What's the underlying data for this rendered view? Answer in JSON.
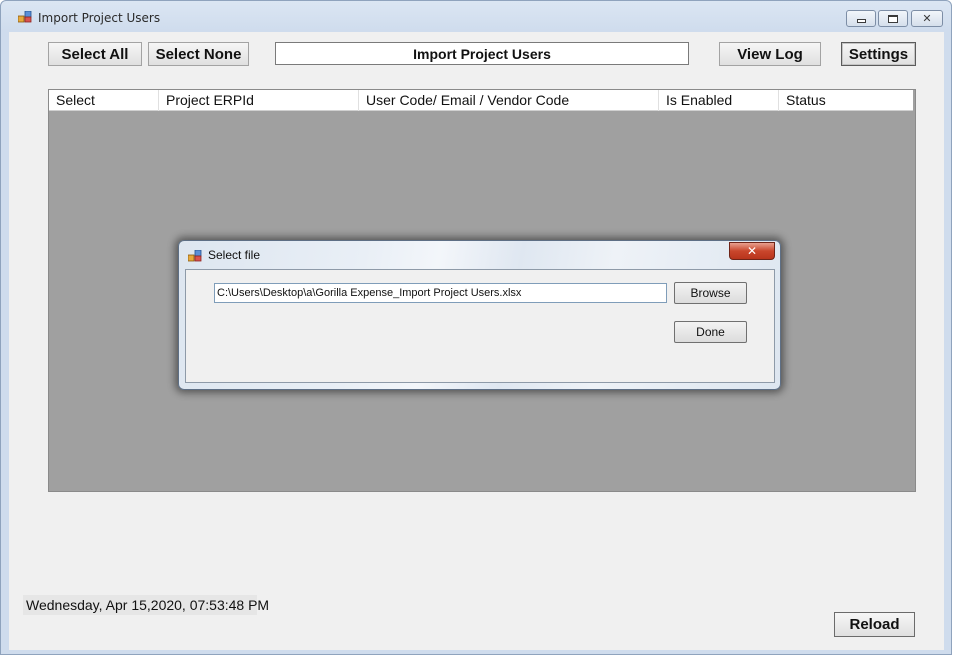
{
  "window": {
    "title": "Import Project Users"
  },
  "toolbar": {
    "select_all": "Select All",
    "select_none": "Select None",
    "title_box": "Import Project Users",
    "view_log": "View Log",
    "settings": "Settings"
  },
  "grid": {
    "columns": [
      "Select",
      "Project ERPId",
      "User Code/ Email / Vendor Code",
      "Is Enabled",
      "Status"
    ]
  },
  "footer": {
    "datetime": "Wednesday, Apr 15,2020, 07:53:48 PM",
    "reload": "Reload"
  },
  "dialog": {
    "title": "Select file",
    "close_glyph": "✕",
    "file_path": "C:\\Users\\Desktop\\a\\Gorilla Expense_Import Project Users.xlsx",
    "browse": "Browse",
    "done": "Done"
  },
  "colors": {
    "grid_background": "#a0a0a0",
    "client_background": "#f0f0f0",
    "dialog_close": "#c9462c"
  },
  "icons": {
    "app": "app-window-icon",
    "minimize": "minimize-icon",
    "maximize": "maximize-icon",
    "close": "close-icon"
  }
}
